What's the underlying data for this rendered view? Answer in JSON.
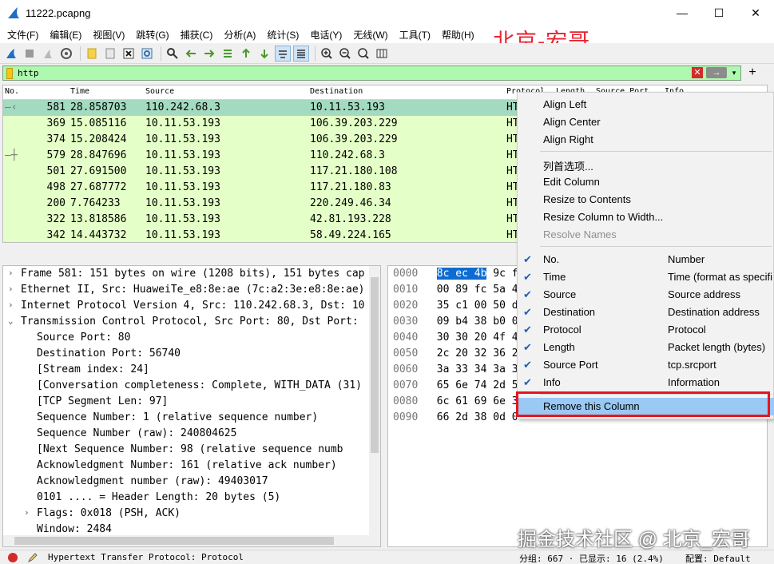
{
  "window": {
    "title": "11222.pcapng",
    "minimize": "—",
    "maximize": "☐",
    "close": "✕"
  },
  "menu": [
    "文件(F)",
    "编辑(E)",
    "视图(V)",
    "跳转(G)",
    "捕获(C)",
    "分析(A)",
    "统计(S)",
    "电话(Y)",
    "无线(W)",
    "工具(T)",
    "帮助(H)"
  ],
  "watermark_top": "北京-宏哥",
  "watermark_bottom": "掘金技术社区 @ 北京_宏哥",
  "filter": {
    "value": "http",
    "clear": "✕",
    "apply": "→",
    "add": "+"
  },
  "packet_list": {
    "headers": [
      "No.",
      "Time",
      "Source",
      "Destination",
      "Protocol",
      "Length",
      "Source Port",
      "Info"
    ],
    "rows": [
      {
        "no": "581",
        "time": "28.858703",
        "src": "110.242.68.3",
        "dst": "10.11.53.193",
        "proto": "HT",
        "selected": true
      },
      {
        "no": "369",
        "time": "15.085116",
        "src": "10.11.53.193",
        "dst": "106.39.203.229",
        "proto": "HT",
        "selected": false
      },
      {
        "no": "374",
        "time": "15.208424",
        "src": "10.11.53.193",
        "dst": "106.39.203.229",
        "proto": "HT",
        "selected": false
      },
      {
        "no": "579",
        "time": "28.847696",
        "src": "10.11.53.193",
        "dst": "110.242.68.3",
        "proto": "HT",
        "selected": false
      },
      {
        "no": "501",
        "time": "27.691500",
        "src": "10.11.53.193",
        "dst": "117.21.180.108",
        "proto": "HT",
        "selected": false
      },
      {
        "no": "498",
        "time": "27.687772",
        "src": "10.11.53.193",
        "dst": "117.21.180.83",
        "proto": "HT",
        "selected": false
      },
      {
        "no": "200",
        "time": "7.764233",
        "src": "10.11.53.193",
        "dst": "220.249.46.34",
        "proto": "HT",
        "selected": false
      },
      {
        "no": "322",
        "time": "13.818586",
        "src": "10.11.53.193",
        "dst": "42.81.193.228",
        "proto": "HT",
        "selected": false
      },
      {
        "no": "342",
        "time": "14.443732",
        "src": "10.11.53.193",
        "dst": "58.49.224.165",
        "proto": "HT",
        "selected": false
      }
    ]
  },
  "details": [
    {
      "indent": 0,
      "arrow": "›",
      "text": "Frame 581: 151 bytes on wire (1208 bits), 151 bytes cap"
    },
    {
      "indent": 0,
      "arrow": "›",
      "text": "Ethernet II, Src: HuaweiTe_e8:8e:ae (7c:a2:3e:e8:8e:ae)"
    },
    {
      "indent": 0,
      "arrow": "›",
      "text": "Internet Protocol Version 4, Src: 110.242.68.3, Dst: 10"
    },
    {
      "indent": 0,
      "arrow": "⌄",
      "text": "Transmission Control Protocol, Src Port: 80, Dst Port:"
    },
    {
      "indent": 1,
      "arrow": "",
      "text": "Source Port: 80"
    },
    {
      "indent": 1,
      "arrow": "",
      "text": "Destination Port: 56740"
    },
    {
      "indent": 1,
      "arrow": "",
      "text": "[Stream index: 24]"
    },
    {
      "indent": 1,
      "arrow": "",
      "text": "[Conversation completeness: Complete, WITH_DATA (31)"
    },
    {
      "indent": 1,
      "arrow": "",
      "text": "[TCP Segment Len: 97]"
    },
    {
      "indent": 1,
      "arrow": "",
      "text": "Sequence Number: 1    (relative sequence number)"
    },
    {
      "indent": 1,
      "arrow": "",
      "text": "Sequence Number (raw): 240804625"
    },
    {
      "indent": 1,
      "arrow": "",
      "text": "[Next Sequence Number: 98    (relative sequence numb"
    },
    {
      "indent": 1,
      "arrow": "",
      "text": "Acknowledgment Number: 161    (relative ack number)"
    },
    {
      "indent": 1,
      "arrow": "",
      "text": "Acknowledgment number (raw): 49403017"
    },
    {
      "indent": 1,
      "arrow": "",
      "text": "0101 .... = Header Length: 20 bytes (5)"
    },
    {
      "indent": 1,
      "arrow": "›",
      "text": "Flags: 0x018 (PSH, ACK)"
    },
    {
      "indent": 1,
      "arrow": "",
      "text": "Window: 2484"
    }
  ],
  "bytes": [
    {
      "offset": "0000",
      "hl": "8c ec 4b",
      "rest": " 9c f"
    },
    {
      "offset": "0010",
      "hl": "",
      "rest": "00 89 fc 5a 4"
    },
    {
      "offset": "0020",
      "hl": "",
      "rest": "35 c1 00 50 d"
    },
    {
      "offset": "0030",
      "hl": "",
      "rest": "09 b4 38 b0 0"
    },
    {
      "offset": "0040",
      "hl": "",
      "rest": "30 30 20 4f 4"
    },
    {
      "offset": "0050",
      "hl": "",
      "rest": "2c 20 32 36 2"
    },
    {
      "offset": "0060",
      "hl": "",
      "rest": "3a 33 34 3a 3"
    },
    {
      "offset": "0070",
      "hl": "",
      "rest": "65 6e 74 2d 5"
    },
    {
      "offset": "0080",
      "hl": "",
      "rest": "6c 61 69 6e 3"
    },
    {
      "offset": "0090",
      "hl": "",
      "rest": "66 2d 38 0d 0"
    }
  ],
  "context_menu": {
    "align": [
      "Align Left",
      "Align Center",
      "Align Right"
    ],
    "edit": [
      "列首选项...",
      "Edit Column",
      "Resize to Contents",
      "Resize Column to Width..."
    ],
    "resolve": "Resolve Names",
    "columns": [
      {
        "label": "No.",
        "hint": "Number",
        "checked": true
      },
      {
        "label": "Time",
        "hint": "Time (format as specifi",
        "checked": true
      },
      {
        "label": "Source",
        "hint": "Source address",
        "checked": true
      },
      {
        "label": "Destination",
        "hint": "Destination address",
        "checked": true
      },
      {
        "label": "Protocol",
        "hint": "Protocol",
        "checked": true
      },
      {
        "label": "Length",
        "hint": "Packet length (bytes)",
        "checked": true
      },
      {
        "label": "Source Port",
        "hint": "tcp.srcport",
        "checked": true
      },
      {
        "label": "Info",
        "hint": "Information",
        "checked": true
      }
    ],
    "remove": "Remove this Column"
  },
  "status": {
    "protocol_text": "Hypertext Transfer Protocol: Protocol",
    "packets": "分组: 667 · 已显示: 16 (2.4%)",
    "profile": "配置: Default"
  },
  "colors": {
    "row_bg": "#e4ffc7",
    "row_selected": "#a3dac0",
    "filter_ok": "#aff8af",
    "menu_hover": "#99c9f4",
    "highlight_box": "#e8141e"
  }
}
